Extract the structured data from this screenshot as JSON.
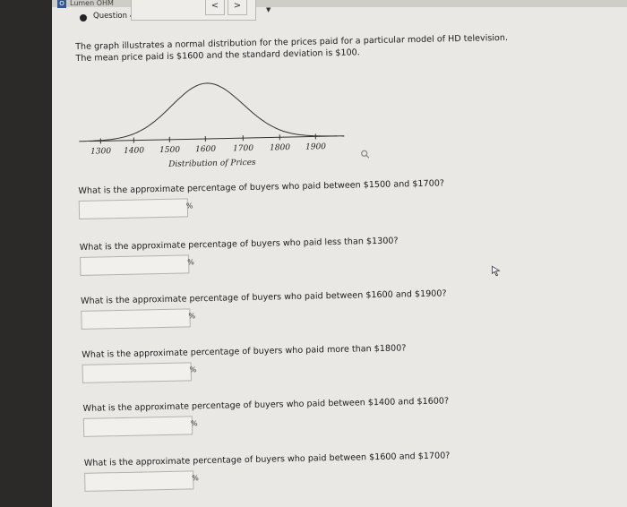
{
  "app": {
    "title": "Lumen OHM",
    "logo_glyph": "O"
  },
  "header": {
    "question_label": "Question 4",
    "prev": "<",
    "next": ">",
    "select_arrow": "▼"
  },
  "intro": {
    "line1": "The graph illustrates a normal distribution for the prices paid for a particular model of HD television.",
    "line2": "The mean price paid is $1600 and the standard deviation is $100."
  },
  "chart_data": {
    "type": "line",
    "title": "",
    "xlabel": "Distribution of Prices",
    "ylabel": "",
    "x_ticks": [
      "1300",
      "1400",
      "1500",
      "1600",
      "1700",
      "1800",
      "1900"
    ],
    "mean": 1600,
    "std": 100,
    "xlim": [
      1300,
      1900
    ],
    "curve": "normal"
  },
  "questions": [
    {
      "text": "What is the approximate percentage of buyers who paid between $1500 and $1700?",
      "value": "",
      "unit": "%"
    },
    {
      "text": "What is the approximate percentage of buyers who paid less than $1300?",
      "value": "",
      "unit": "%"
    },
    {
      "text": "What is the approximate percentage of buyers who paid between $1600 and $1900?",
      "value": "",
      "unit": "%"
    },
    {
      "text": "What is the approximate percentage of buyers who paid more than $1800?",
      "value": "",
      "unit": "%"
    },
    {
      "text": "What is the approximate percentage of buyers who paid between $1400 and $1600?",
      "value": "",
      "unit": "%"
    },
    {
      "text": "What is the approximate percentage of buyers who paid between $1600 and $1700?",
      "value": "",
      "unit": "%"
    }
  ],
  "icons": {
    "search": "search-icon",
    "cursor": "cursor-icon"
  }
}
